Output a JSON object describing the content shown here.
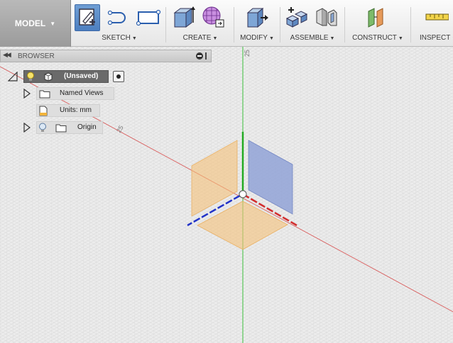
{
  "toolbar": {
    "workspace": {
      "label": "MODEL"
    },
    "groups": [
      {
        "id": "sketch",
        "label": "SKETCH"
      },
      {
        "id": "create",
        "label": "CREATE"
      },
      {
        "id": "modify",
        "label": "MODIFY"
      },
      {
        "id": "assemble",
        "label": "ASSEMBLE"
      },
      {
        "id": "construct",
        "label": "CONSTRUCT"
      },
      {
        "id": "inspect",
        "label": "INSPECT"
      }
    ]
  },
  "browser": {
    "title": "BROWSER",
    "nodes": [
      {
        "label": "(Unsaved)"
      },
      {
        "label": "Named Views"
      },
      {
        "label": "Units: mm"
      },
      {
        "label": "Origin"
      }
    ]
  },
  "viewport": {
    "ruler_labels": [
      "25",
      "25"
    ],
    "colors": {
      "x_axis": "#d94a4a",
      "y_axis": "#33bb33",
      "plane_orange": "#f5c27a",
      "plane_blue": "#8c9fd6"
    }
  }
}
